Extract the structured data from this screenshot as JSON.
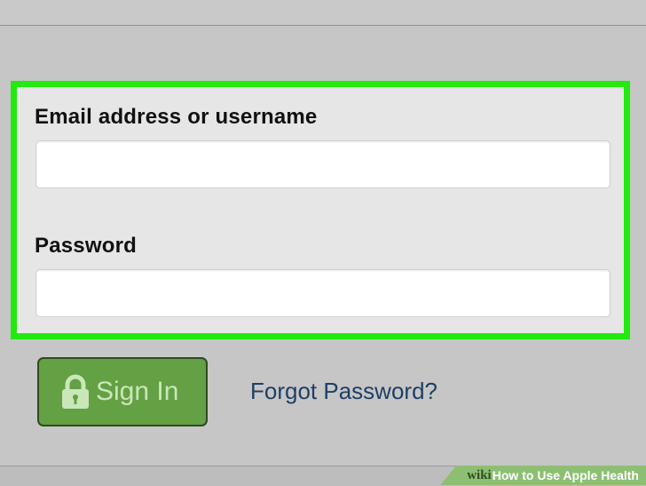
{
  "form": {
    "email_label": "Email address or username",
    "email_value": "",
    "password_label": "Password",
    "password_value": "",
    "signin_label": "Sign In",
    "forgot_label": "Forgot Password?"
  },
  "icons": {
    "signin_icon": "lock-icon"
  },
  "colors": {
    "highlight": "#21ea0c",
    "button": "#64a044",
    "link": "#1e3f66"
  },
  "watermark": {
    "wiki": "wiki",
    "how": "How",
    "title": "to Use Apple Health"
  }
}
